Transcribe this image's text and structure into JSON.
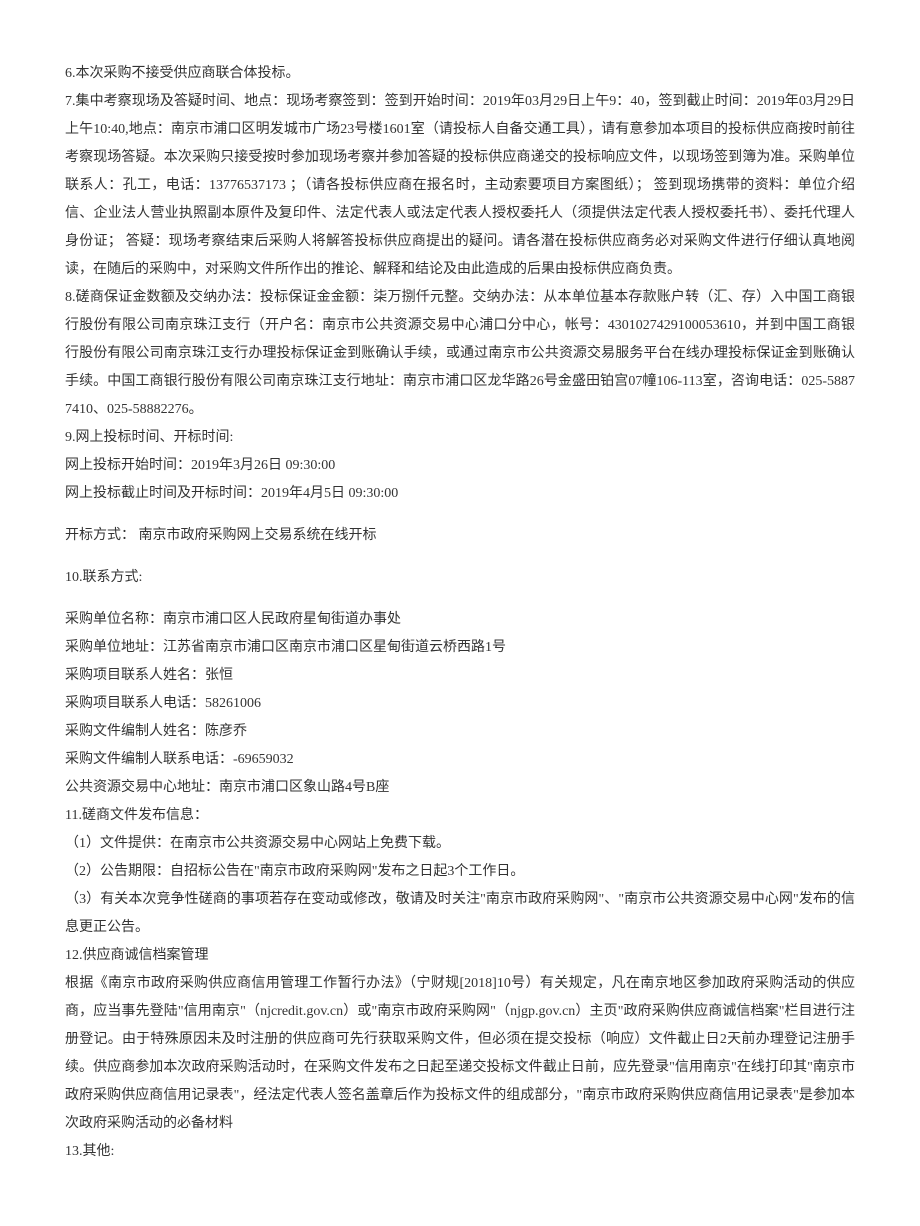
{
  "paragraphs": {
    "p6": "6.本次采购不接受供应商联合体投标。",
    "p7": "7.集中考察现场及答疑时间、地点：现场考察签到：签到开始时间：2019年03月29日上午9：40，签到截止时间：2019年03月29日上午10:40,地点：南京市浦口区明发城市广场23号楼1601室（请投标人自备交通工具），请有意参加本项目的投标供应商按时前往考察现场答疑。本次采购只接受按时参加现场考察并参加答疑的投标供应商递交的投标响应文件，以现场签到簿为准。采购单位联系人：孔工，电话：13776537173 ；（请各投标供应商在报名时，主动索要项目方案图纸）； 签到现场携带的资料：单位介绍信、企业法人营业执照副本原件及复印件、法定代表人或法定代表人授权委托人（须提供法定代表人授权委托书）、委托代理人身份证； 答疑：现场考察结束后采购人将解答投标供应商提出的疑问。请各潜在投标供应商务必对采购文件进行仔细认真地阅读，在随后的采购中，对采购文件所作出的推论、解释和结论及由此造成的后果由投标供应商负责。",
    "p8": "8.磋商保证金数额及交纳办法：投标保证金金额：柒万捌仟元整。交纳办法：从本单位基本存款账户转（汇、存）入中国工商银行股份有限公司南京珠江支行（开户名：南京市公共资源交易中心浦口分中心，帐号：4301027429100053610，并到中国工商银行股份有限公司南京珠江支行办理投标保证金到账确认手续，或通过南京市公共资源交易服务平台在线办理投标保证金到账确认手续。中国工商银行股份有限公司南京珠江支行地址：南京市浦口区龙华路26号金盛田铂宫07幢106-113室，咨询电话：025-58877410、025-58882276。",
    "p9_title": "9.网上投标时间、开标时间:",
    "p9_start": "网上投标开始时间：2019年3月26日 09:30:00",
    "p9_end": "网上投标截止时间及开标时间：2019年4月5日 09:30:00",
    "p_method": "开标方式：  南京市政府采购网上交易系统在线开标",
    "p10_title": "10.联系方式:",
    "p10_unit_name": "采购单位名称：南京市浦口区人民政府星甸街道办事处",
    "p10_unit_addr": "采购单位地址：江苏省南京市浦口区南京市浦口区星甸街道云桥西路1号",
    "p10_contact_name": "采购项目联系人姓名：张恒",
    "p10_contact_phone": "采购项目联系人电话：58261006",
    "p10_editor_name": "采购文件编制人姓名：陈彦乔",
    "p10_editor_phone": "采购文件编制人联系电话：-69659032",
    "p10_center_addr": "公共资源交易中心地址：南京市浦口区象山路4号B座",
    "p11_title": "11.磋商文件发布信息：",
    "p11_1": "（1）文件提供：在南京市公共资源交易中心网站上免费下载。",
    "p11_2": "（2）公告期限：自招标公告在\"南京市政府采购网\"发布之日起3个工作日。",
    "p11_3": "（3）有关本次竞争性磋商的事项若存在变动或修改，敬请及时关注\"南京市政府采购网\"、\"南京市公共资源交易中心网\"发布的信息更正公告。",
    "p12_title": "12.供应商诚信档案管理",
    "p12_body": "根据《南京市政府采购供应商信用管理工作暂行办法》（宁财规[2018]10号）有关规定，凡在南京地区参加政府采购活动的供应商，应当事先登陆\"信用南京\"（njcredit.gov.cn）或\"南京市政府采购网\"（njgp.gov.cn）主页\"政府采购供应商诚信档案\"栏目进行注册登记。由于特殊原因未及时注册的供应商可先行获取采购文件，但必须在提交投标（响应）文件截止日2天前办理登记注册手续。供应商参加本次政府采购活动时，在采购文件发布之日起至递交投标文件截止日前，应先登录\"信用南京\"在线打印其\"南京市政府采购供应商信用记录表\"，经法定代表人签名盖章后作为投标文件的组成部分，\"南京市政府采购供应商信用记录表\"是参加本次政府采购活动的必备材料",
    "p13": "13.其他:"
  }
}
